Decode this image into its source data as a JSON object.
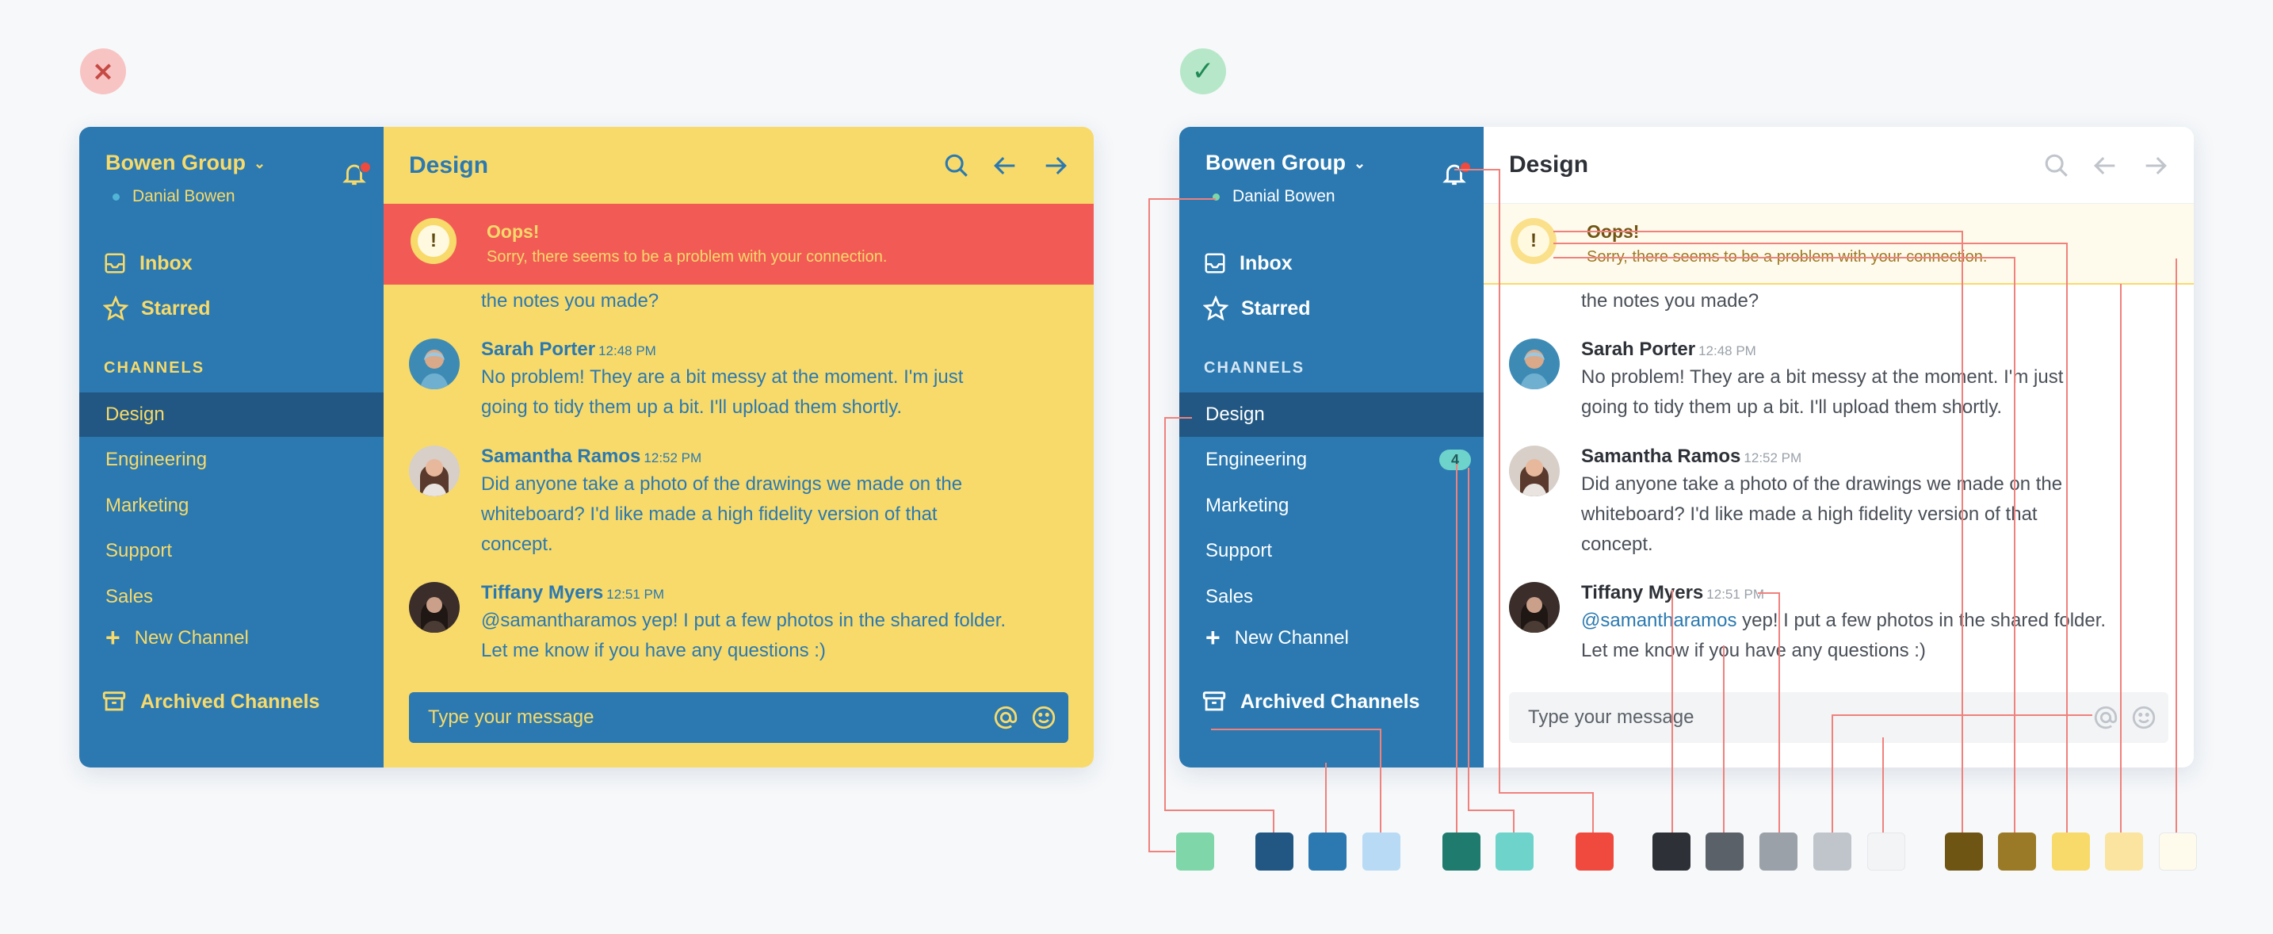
{
  "examples": {
    "bad_mark": "×",
    "good_mark": "✓"
  },
  "sidebar": {
    "workspace": "Bowen Group",
    "user": "Danial Bowen",
    "inbox": "Inbox",
    "starred": "Starred",
    "channels_title": "CHANNELS",
    "channels": [
      {
        "name": "Design"
      },
      {
        "name": "Engineering",
        "unread": "4"
      },
      {
        "name": "Marketing"
      },
      {
        "name": "Support"
      },
      {
        "name": "Sales"
      }
    ],
    "new_channel": "New Channel",
    "archived": "Archived Channels"
  },
  "main": {
    "title": "Design",
    "alert": {
      "title": "Oops!",
      "message": "Sorry, there seems to be a problem with your connection."
    },
    "clipped_text": "the notes you made?",
    "messages": [
      {
        "author": "Sarah Porter",
        "time": "12:48 PM",
        "lines": [
          "No problem! They are a bit messy at the moment. I'm just",
          "going to tidy them up a bit. I'll upload them shortly."
        ]
      },
      {
        "author": "Samantha Ramos",
        "time": "12:52 PM",
        "lines": [
          "Did anyone take a photo of the drawings we made on the",
          "whiteboard? I'd like made a high fidelity version of that",
          "concept."
        ]
      },
      {
        "author": "Tiffany Myers",
        "time": "12:51 PM",
        "mention": "@samantharamos",
        "line1_rest": " yep! I put a few photos in the shared folder.",
        "line2": "Let me know if you have any questions :)"
      }
    ],
    "composer_placeholder": "Type your message"
  },
  "palette": [
    {
      "group": "green",
      "hex": "#7fd6a8"
    },
    {
      "group": "blue",
      "hex": "#215782"
    },
    {
      "group": "blue",
      "hex": "#2b79b0"
    },
    {
      "group": "blue",
      "hex": "#b8daf5"
    },
    {
      "group": "teal",
      "hex": "#1f7b6d"
    },
    {
      "group": "teal",
      "hex": "#6ed4cb"
    },
    {
      "group": "red",
      "hex": "#ef4a3d"
    },
    {
      "group": "grey",
      "hex": "#2d3137"
    },
    {
      "group": "grey",
      "hex": "#5b6168"
    },
    {
      "group": "grey",
      "hex": "#9aa1a9"
    },
    {
      "group": "grey",
      "hex": "#c0c5cb"
    },
    {
      "group": "grey",
      "hex": "#f3f4f6"
    },
    {
      "group": "yellow",
      "hex": "#6e5514"
    },
    {
      "group": "yellow",
      "hex": "#9a7a26"
    },
    {
      "group": "yellow",
      "hex": "#f8da6b"
    },
    {
      "group": "yellow",
      "hex": "#fae4a0"
    },
    {
      "group": "yellow",
      "hex": "#fffbec"
    }
  ],
  "colors": {
    "sidebar_blue": "#2b79b0",
    "active_channel": "#215782",
    "bad_accent_yellow": "#f8da6b",
    "bad_alert_red": "#f25b55",
    "annotation_line": "#f0817c"
  }
}
